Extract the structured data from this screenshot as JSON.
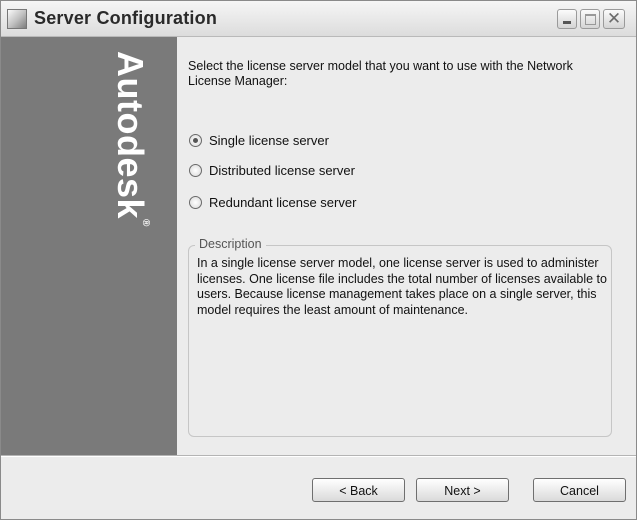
{
  "window": {
    "title": "Server Configuration"
  },
  "brand": {
    "name": "Autodesk",
    "trademark": "®"
  },
  "main": {
    "intro": "Select the license server model that you want to use with the Network License Manager:",
    "options": [
      {
        "label": "Single license server",
        "checked": true
      },
      {
        "label": "Distributed license server",
        "checked": false
      },
      {
        "label": "Redundant license server",
        "checked": false
      }
    ],
    "description": {
      "legend": "Description",
      "text": "In a single license server model, one license server is used to administer licenses.  One license file includes the total number of licenses available to users.  Because license management takes place on a single server, this model requires the least amount of maintenance."
    }
  },
  "footer": {
    "back_label": "< Back",
    "next_label": "Next >",
    "cancel_label": "Cancel"
  },
  "colors": {
    "brand_panel": "#7a7a7a",
    "dialog_bg": "#ececec"
  },
  "icons": {
    "app": "app-window-icon",
    "minimize": "minimize-icon",
    "maximize": "maximize-icon",
    "close": "close-icon"
  }
}
